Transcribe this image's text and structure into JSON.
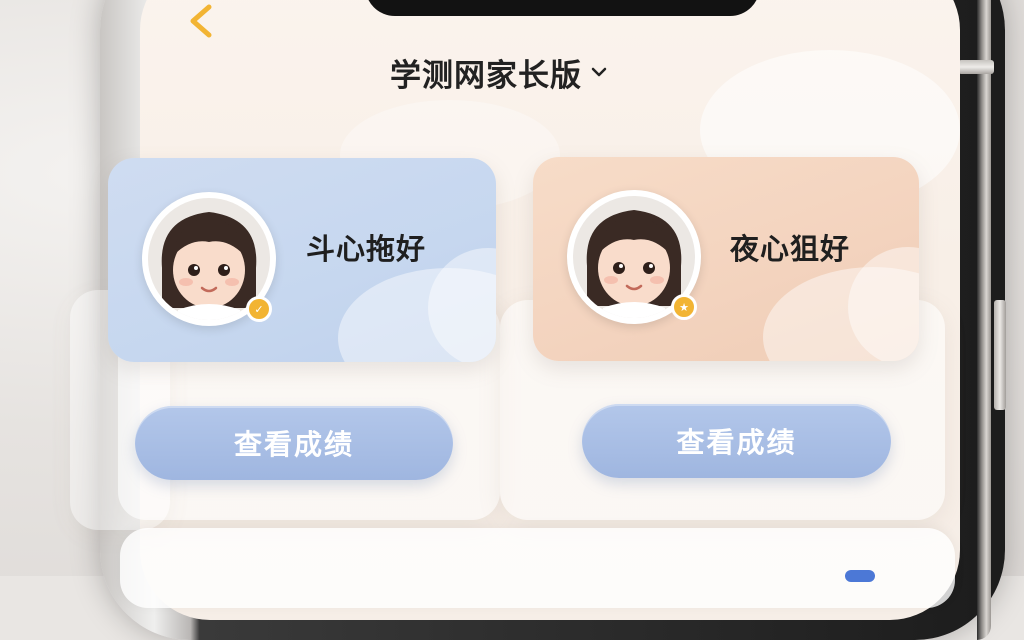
{
  "header": {
    "title": "学测网家长版",
    "back_icon": "chevron-left-icon",
    "title_dropdown_icon": "chevron-down-icon"
  },
  "children": [
    {
      "name": "斗心拖好",
      "badge": "✓",
      "theme": "blue",
      "button_label": "查看成绩"
    },
    {
      "name": "夜心狙好",
      "badge": "★",
      "theme": "peach",
      "button_label": "查看成绩"
    }
  ],
  "colors": {
    "accent_orange": "#f2b433",
    "button_blue": "#a9bfe6",
    "card_blue": "#c6d7ef",
    "card_peach": "#f3d3be"
  }
}
